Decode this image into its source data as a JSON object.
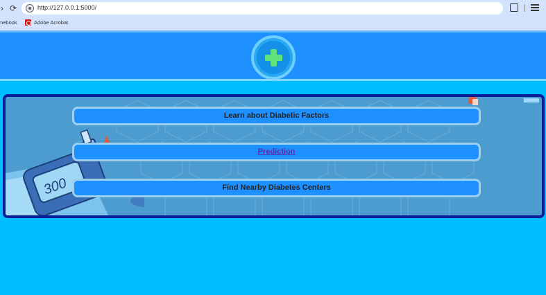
{
  "browser": {
    "url": "http://127.0.0.1:5000/",
    "bookmarks": [
      {
        "label": "mebook"
      },
      {
        "label": "Adobe Acrobat"
      }
    ]
  },
  "menu": {
    "items": [
      {
        "label": "Learn about Diabetic Factors"
      },
      {
        "label": "Prediction"
      },
      {
        "label": "Find Nearby Diabetes Centers"
      }
    ]
  },
  "meter": {
    "reading": "300"
  },
  "colors": {
    "page_bg": "#00bfff",
    "header_bg": "#1e90ff",
    "panel_border": "#0c1f9a",
    "logo_plus": "#5fe37a"
  }
}
